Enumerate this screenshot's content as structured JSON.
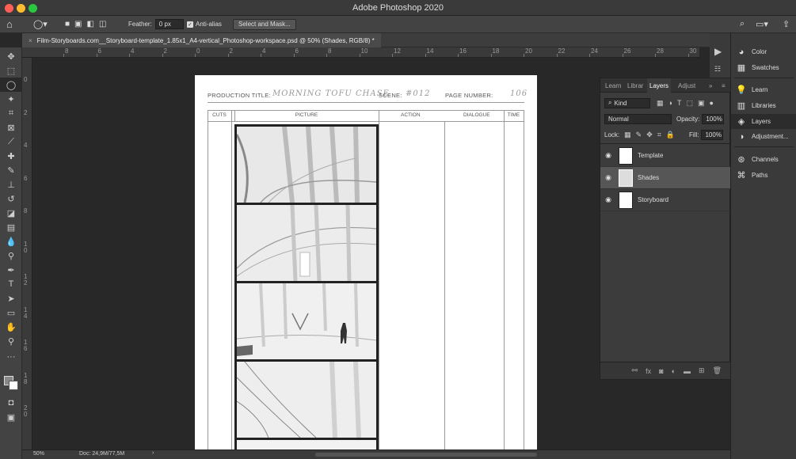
{
  "app": {
    "window_title": "Adobe Photoshop 2020"
  },
  "options_bar": {
    "feather_label": "Feather:",
    "feather_value": "0 px",
    "antialias_label": "Anti-alias",
    "select_mask_label": "Select and Mask..."
  },
  "document": {
    "tab_title": "Film-Storyboards.com__Storyboard-template_1.85x1_A4-vertical_Photoshop-workspace.psd @ 50% (Shades, RGB/8) *",
    "close_glyph": "×"
  },
  "ruler": {
    "h_labels": [
      "8",
      "6",
      "4",
      "2",
      "0",
      "2",
      "4",
      "6",
      "8",
      "10",
      "12",
      "14",
      "16",
      "18",
      "20",
      "22",
      "24",
      "26",
      "28",
      "30"
    ],
    "v_labels": [
      "0",
      "2",
      "4",
      "6",
      "8",
      "1 0",
      "1 2",
      "1 4",
      "1 6",
      "1 8",
      "2 0"
    ]
  },
  "storyboard": {
    "production_title_label": "PRODUCTION TITLE:",
    "production_title_value": "MORNING TOFU CHASE",
    "scene_label": "SCENE:",
    "scene_value": "#012",
    "page_number_label": "PAGE NUMBER:",
    "page_number_value": "106",
    "columns": [
      "CUTS",
      "PICTURE",
      "ACTION",
      "DIALOGUE",
      "TIME"
    ]
  },
  "status": {
    "zoom": "50%",
    "doc_info": "Doc: 24,9M/77,5M",
    "arrow": "›"
  },
  "layers_panel": {
    "tabs": [
      "Learn",
      "Librar",
      "Layers",
      "Adjust"
    ],
    "filter_kind": "Kind",
    "blend_mode": "Normal",
    "opacity_label": "Opacity:",
    "opacity_value": "100%",
    "lock_label": "Lock:",
    "fill_label": "Fill:",
    "fill_value": "100%",
    "layers": [
      {
        "name": "Template"
      },
      {
        "name": "Shades"
      },
      {
        "name": "Storyboard"
      }
    ],
    "selected_layer": "Shades"
  },
  "right_dock": {
    "items": [
      "Color",
      "Swatches",
      "Learn",
      "Libraries",
      "Layers",
      "Adjustment...",
      "Channels",
      "Paths"
    ]
  },
  "colors": {
    "accent": "#2c2c2c",
    "panel": "#3c3c3c",
    "selected_layer": "#565656"
  }
}
